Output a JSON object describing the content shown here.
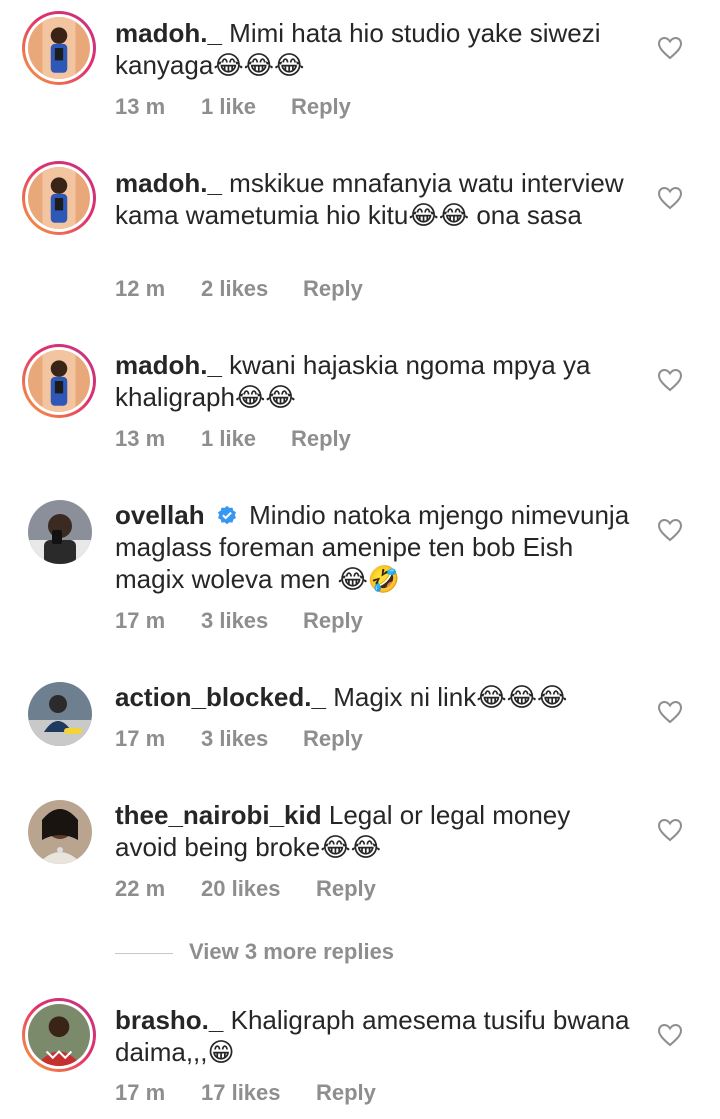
{
  "comments": [
    {
      "username": "madoh._",
      "text": "Mimi hata hio studio yake siwezi kanyaga😂😂😂",
      "time": "13 m",
      "likes": "1 like",
      "reply": "Reply",
      "verified": false,
      "story_ring": true,
      "avatar_color": "#e9a87a"
    },
    {
      "username": "madoh._",
      "text": "mskikue mnafanyia watu interview kama wametumia hio kitu😂😂 ona sasa",
      "time": "12 m",
      "likes": "2 likes",
      "reply": "Reply",
      "verified": false,
      "story_ring": true,
      "avatar_color": "#e9a87a"
    },
    {
      "username": "madoh._",
      "text": "kwani hajaskia ngoma mpya ya khaligraph😂😂",
      "time": "13 m",
      "likes": "1 like",
      "reply": "Reply",
      "verified": false,
      "story_ring": true,
      "avatar_color": "#e9a87a"
    },
    {
      "username": "ovellah",
      "text": "Mindio natoka mjengo nimevunja maglass foreman amenipe ten bob Eish magix woleva men 😂🤣",
      "time": "17 m",
      "likes": "3 likes",
      "reply": "Reply",
      "verified": true,
      "story_ring": false,
      "avatar_color": "#8a8f99"
    },
    {
      "username": "action_blocked._",
      "text": "Magix ni link😂😂😂",
      "time": "17 m",
      "likes": "3 likes",
      "reply": "Reply",
      "verified": false,
      "story_ring": false,
      "avatar_color": "#6e7f8f"
    },
    {
      "username": "thee_nairobi_kid",
      "text": "Legal or legal money avoid being broke😂😂",
      "time": "22 m",
      "likes": "20 likes",
      "reply": "Reply",
      "verified": false,
      "story_ring": false,
      "avatar_color": "#b9a48f"
    },
    {
      "username": "brasho._",
      "text": "Khaligraph amesema tusifu bwana daima,,,😁",
      "time": "17 m",
      "likes": "17 likes",
      "reply": "Reply",
      "verified": false,
      "story_ring": true,
      "avatar_color": "#c62f2f"
    }
  ],
  "view_more_replies": "View 3 more replies",
  "colors": {
    "text": "#262626",
    "meta": "#8e8e8e",
    "verified": "#3897f0",
    "ring_start": "#f9a33b",
    "ring_end": "#c13584"
  },
  "icons": {
    "like": "heart-outline-icon",
    "verified": "verified-badge-icon"
  }
}
